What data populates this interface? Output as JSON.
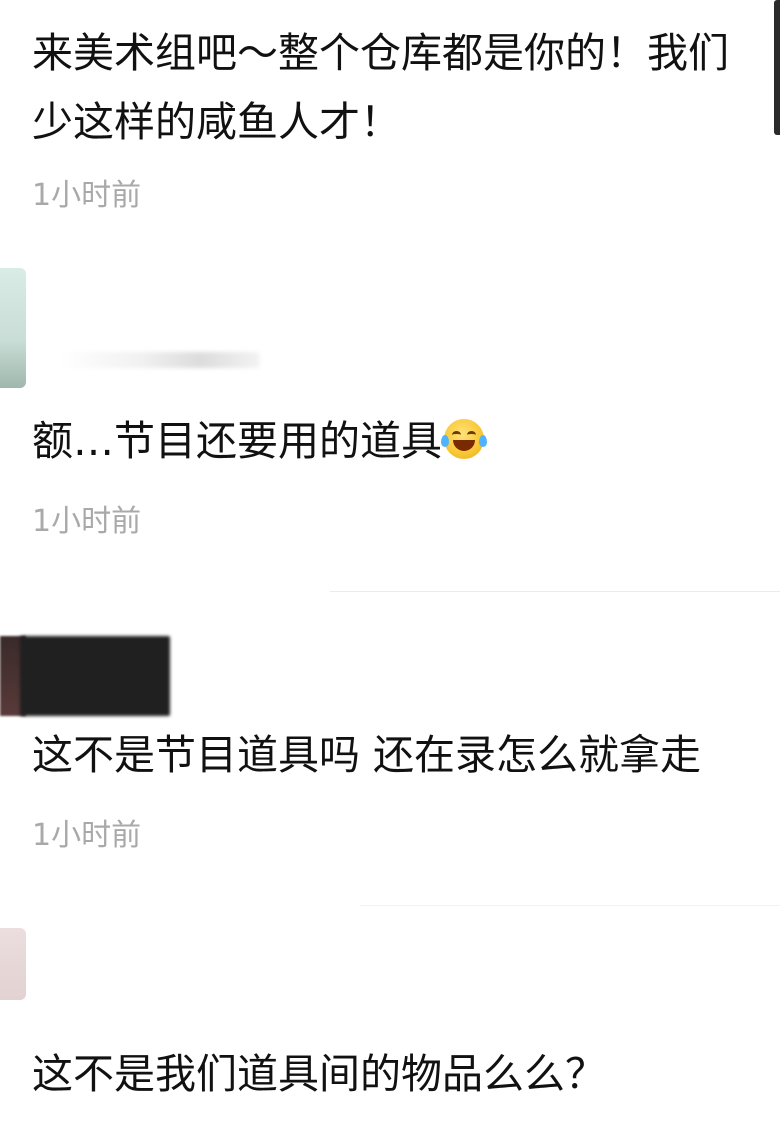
{
  "comments": [
    {
      "text_line1": "来美术组吧～整个仓库都是你的！我们",
      "text_line2": "少这样的咸鱼人才！",
      "timestamp": "1小时前"
    },
    {
      "text": "额…节目还要用的道具",
      "emoji": "laughing-with-tears-emoji",
      "timestamp": "1小时前"
    },
    {
      "text": "这不是节目道具吗 还在录怎么就拿走",
      "timestamp": "1小时前"
    },
    {
      "text": "这不是我们道具间的物品么么？"
    }
  ],
  "colors": {
    "text": "#111111",
    "timestamp": "#a9a9a9",
    "background": "#ffffff"
  }
}
